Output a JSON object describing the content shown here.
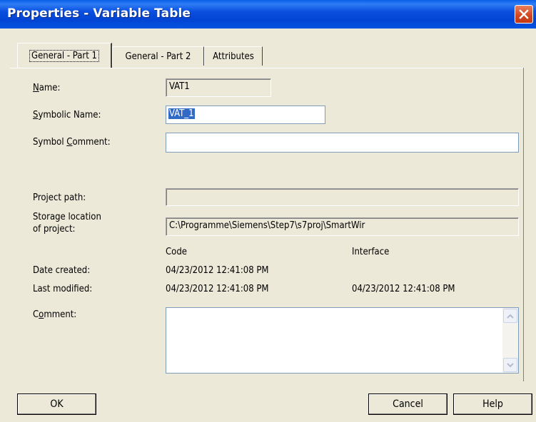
{
  "window": {
    "title": "Properties - Variable Table",
    "close_label": "close"
  },
  "tabs": [
    {
      "label": "General - Part 1",
      "active": true
    },
    {
      "label": "General - Part 2",
      "active": false
    },
    {
      "label": "Attributes",
      "active": false
    }
  ],
  "form": {
    "name": {
      "label_mnemonic": "N",
      "label_rest": "ame:",
      "value": "VAT1"
    },
    "symbolic_name": {
      "label_mnemonic": "S",
      "label_rest": "ymbolic Name:",
      "value": "VAT_1"
    },
    "symbol_comment": {
      "label_pre": "Symbol ",
      "label_mnemonic": "C",
      "label_rest": "omment:",
      "value": ""
    },
    "project_path": {
      "label": "Project path:",
      "value": ""
    },
    "storage_location": {
      "label_line1": "Storage location",
      "label_line2": "of project:",
      "value": "C:\\Programme\\Siemens\\Step7\\s7proj\\SmartWir"
    },
    "columns": {
      "code": "Code",
      "interface": "Interface"
    },
    "date_created": {
      "label": "Date created:",
      "code": "04/23/2012 12:41:08 PM",
      "interface": ""
    },
    "last_modified": {
      "label": "Last modified:",
      "code": "04/23/2012 12:41:08 PM",
      "interface": "04/23/2012 12:41:08 PM"
    },
    "comment": {
      "label_pre": "C",
      "label_mnemonic": "o",
      "label_rest": "mment:",
      "value": ""
    }
  },
  "buttons": {
    "ok": "OK",
    "cancel": "Cancel",
    "help": "Help"
  }
}
